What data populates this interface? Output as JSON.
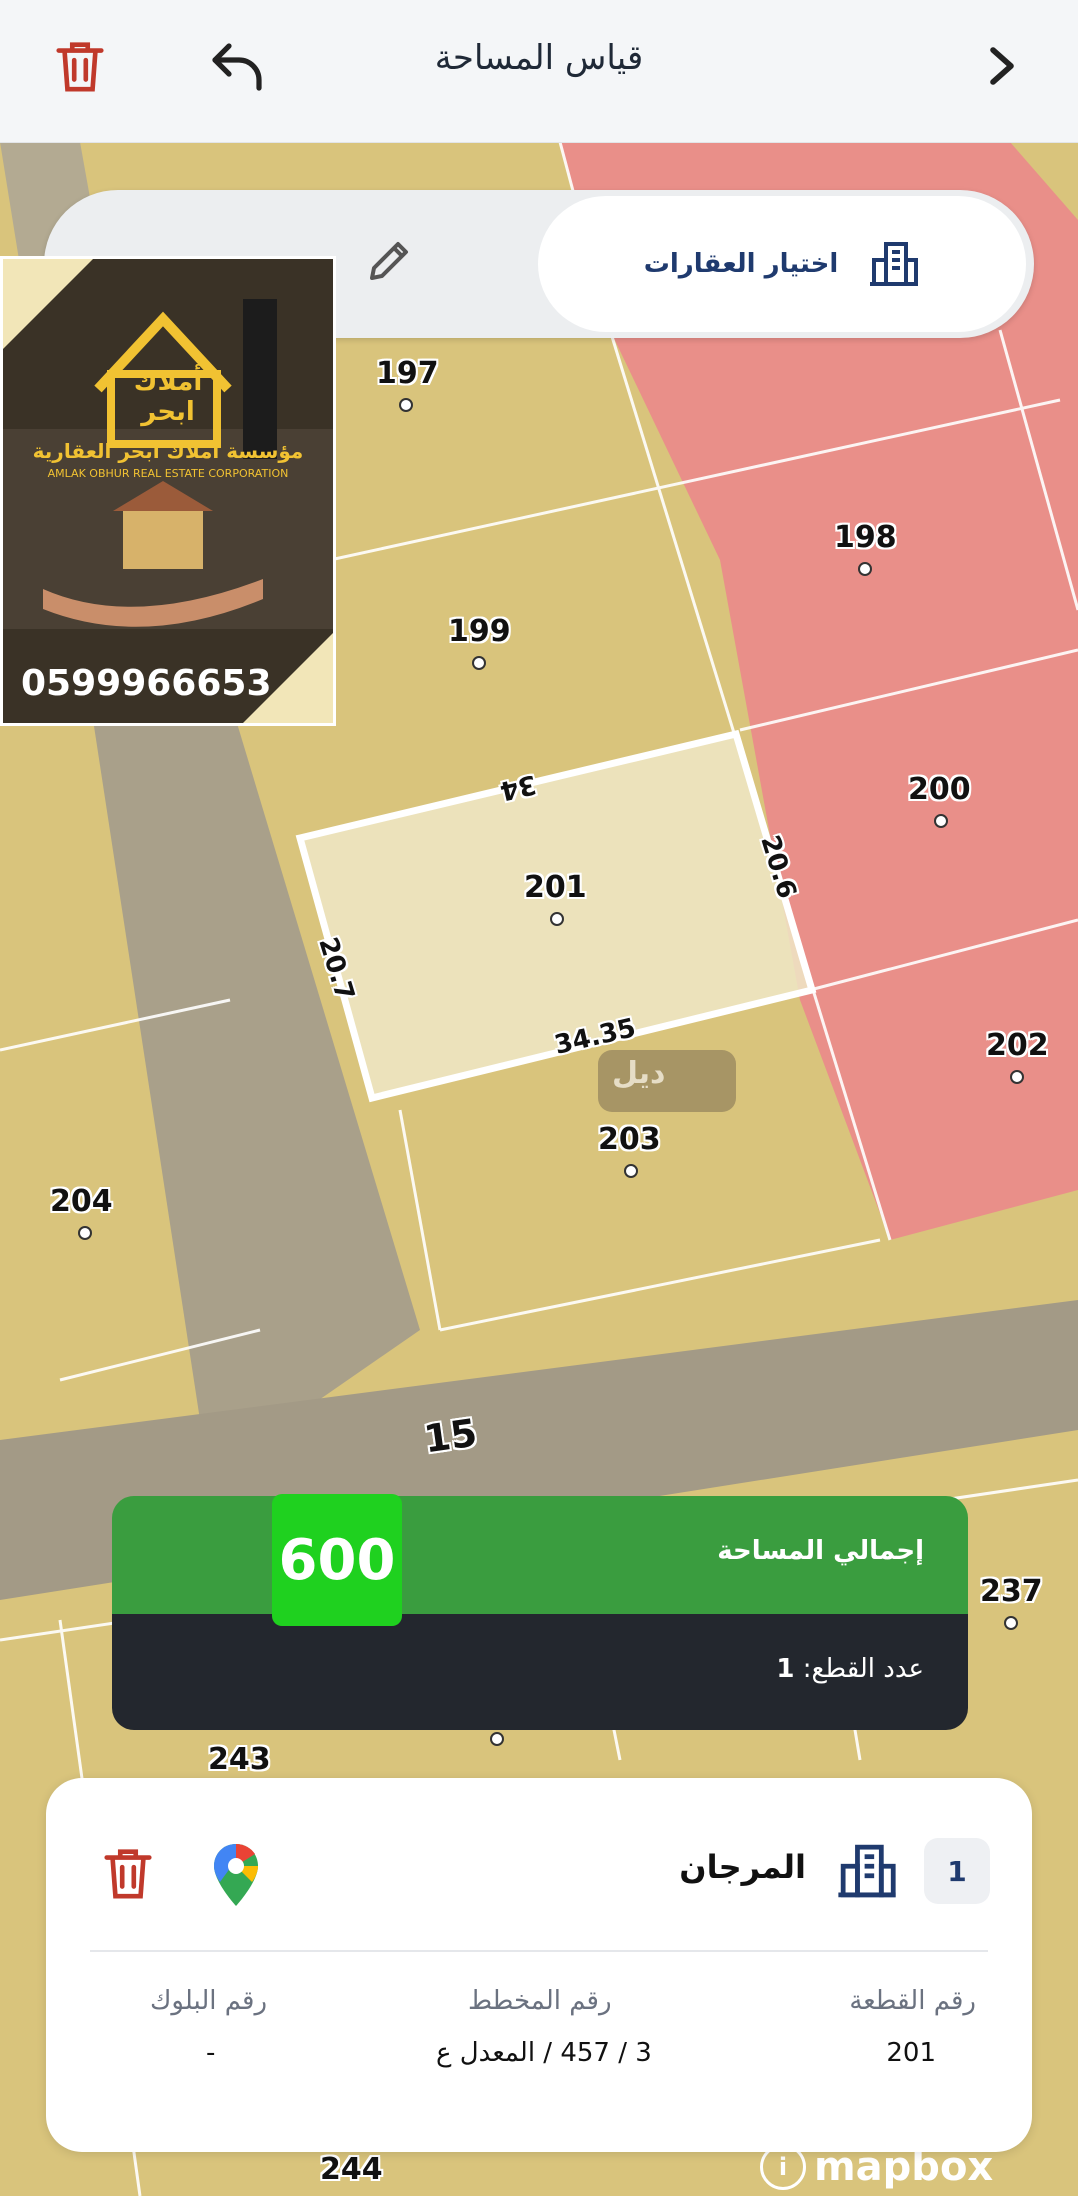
{
  "header": {
    "title": "قياس المساحة"
  },
  "search": {
    "select_label": "اختيار العقارات"
  },
  "ad": {
    "brand": "أملاك ابحر",
    "company_ar": "مؤسسة أملاك ابحر العقارية",
    "company_en": "AMLAK OBHUR REAL ESTATE CORPORATION",
    "phone": "0599966653"
  },
  "map": {
    "parcels": [
      "197",
      "198",
      "199",
      "200",
      "201",
      "202",
      "203",
      "204",
      "237",
      "243",
      "244"
    ],
    "street": "15",
    "dims": {
      "top": "34",
      "right": "20.6",
      "bottom": "34.35",
      "left": "20.7"
    },
    "watermark": "ديل",
    "attribution": "mapbox"
  },
  "summary": {
    "total_label": "إجمالي المساحة",
    "total_value": "600",
    "count_label": "عدد القطع:",
    "count_value": "1"
  },
  "plot_card": {
    "index": "1",
    "name": "المرجان",
    "col1_label": "رقم القطعة",
    "col1_value": "201",
    "col2_label": "رقم المخطط",
    "col2_value": "3 / 457 / المعدل ع",
    "col3_label": "رقم البلوك",
    "col3_value": "-"
  },
  "colors": {
    "header_bg": "#f4f6f8",
    "accent_blue": "#1f3a6e",
    "danger": "#c0392b",
    "area_green": "#3a9d3f",
    "value_green": "#1fd11f",
    "dark": "#23272e",
    "commercial": "#e88e88",
    "residential": "#d8c27a"
  },
  "icons": {
    "delete": "trash-icon",
    "undo": "undo-icon",
    "forward": "chevron-right-icon",
    "edit": "pencil-icon",
    "building": "building-icon",
    "maps": "google-maps-pin-icon"
  }
}
